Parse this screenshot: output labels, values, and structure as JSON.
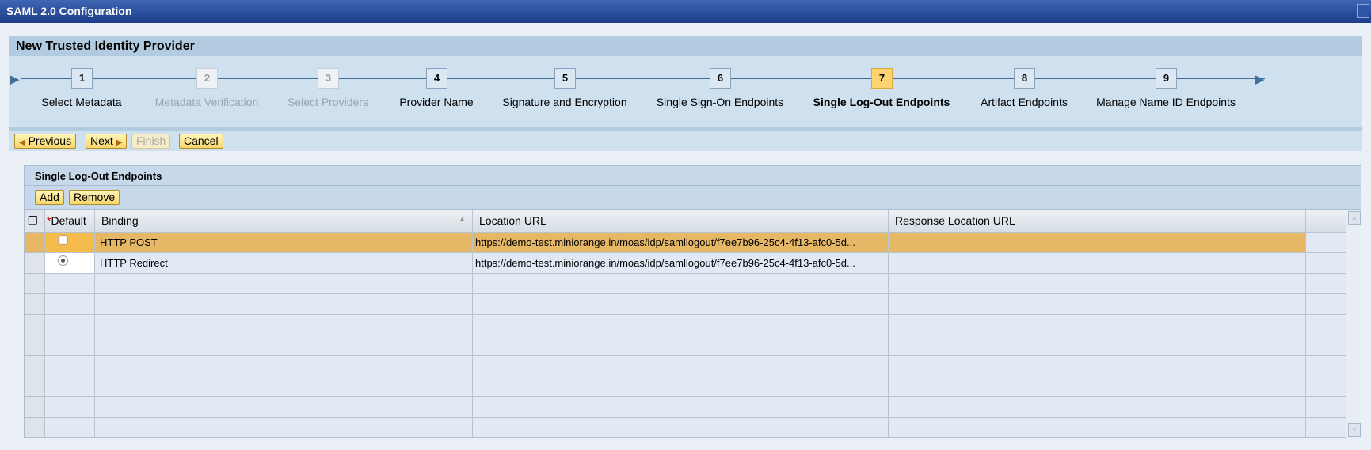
{
  "window": {
    "title": "SAML 2.0 Configuration"
  },
  "wizard": {
    "title": "New Trusted Identity Provider",
    "steps": [
      {
        "num": "1",
        "label": "Select Metadata",
        "state": "done"
      },
      {
        "num": "2",
        "label": "Metadata Verification",
        "state": "disabled"
      },
      {
        "num": "3",
        "label": "Select Providers",
        "state": "disabled"
      },
      {
        "num": "4",
        "label": "Provider Name",
        "state": "done"
      },
      {
        "num": "5",
        "label": "Signature and Encryption",
        "state": "done"
      },
      {
        "num": "6",
        "label": "Single Sign-On Endpoints",
        "state": "done"
      },
      {
        "num": "7",
        "label": "Single Log-Out Endpoints",
        "state": "current"
      },
      {
        "num": "8",
        "label": "Artifact Endpoints",
        "state": "todo"
      },
      {
        "num": "9",
        "label": "Manage Name ID Endpoints",
        "state": "todo"
      }
    ],
    "buttons": {
      "previous": "Previous",
      "next": "Next",
      "finish": "Finish",
      "cancel": "Cancel"
    }
  },
  "section": {
    "title": "Single Log-Out Endpoints",
    "add": "Add",
    "remove": "Remove",
    "columns": {
      "default_required": "*",
      "default": "Default",
      "binding": "Binding",
      "location": "Location URL",
      "response": "Response Location URL"
    },
    "rows": [
      {
        "default": false,
        "binding": "HTTP POST",
        "location": "https://demo-test.miniorange.in/moas/idp/samllogout/f7ee7b96-25c4-4f13-afc0-5d...",
        "response": "",
        "selected": true
      },
      {
        "default": true,
        "binding": "HTTP Redirect",
        "location": "https://demo-test.miniorange.in/moas/idp/samllogout/f7ee7b96-25c4-4f13-afc0-5d...",
        "response": "",
        "selected": false
      }
    ]
  },
  "colors": {
    "title_bar": "#1c3c88",
    "current_step": "#fcd36f",
    "selected_row": "#e6b866"
  }
}
